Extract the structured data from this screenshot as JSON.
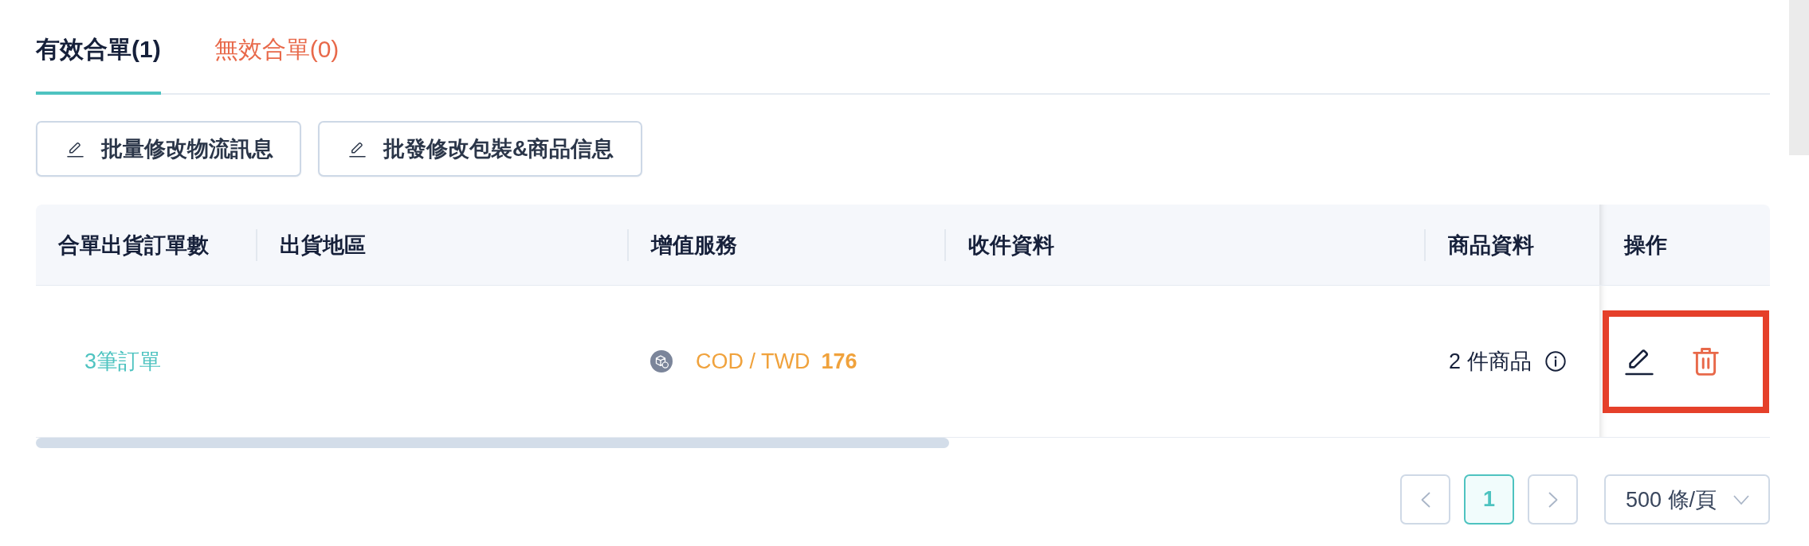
{
  "tabs": [
    {
      "label": "有效合單(1)",
      "selected": true
    },
    {
      "label": "無效合單(0)",
      "selected": false
    }
  ],
  "toolbar": [
    {
      "label": "批量修改物流訊息"
    },
    {
      "label": "批發修改包裝&商品信息"
    }
  ],
  "table": {
    "columns": [
      "合單出貨訂單數",
      "出貨地區",
      "增值服務",
      "收件資料",
      "商品資料",
      "操作"
    ],
    "rows": [
      {
        "order_count": "3筆訂單",
        "service": {
          "label": "COD / TWD",
          "amount": "176"
        },
        "products": "2 件商品",
        "actions_highlighted": true,
        "actions": [
          {
            "kind": "edit"
          },
          {
            "kind": "delete"
          }
        ]
      }
    ]
  },
  "pagination": {
    "prev": {
      "disabled": true
    },
    "pages": [
      {
        "label": "1",
        "selected": true
      }
    ],
    "next": {
      "disabled": true
    },
    "page_size": "500 條/頁"
  }
}
